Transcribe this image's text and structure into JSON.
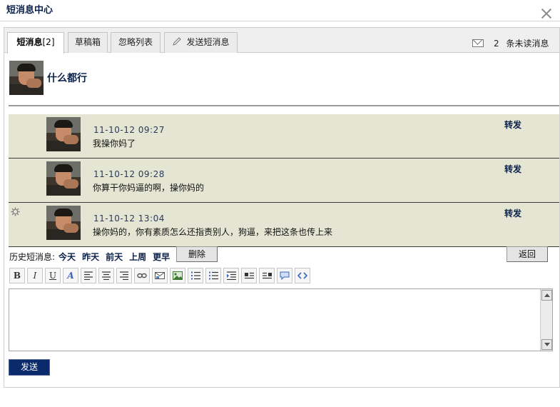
{
  "window": {
    "title": "短消息中心"
  },
  "tabs": {
    "inbox_label": "短消息",
    "inbox_count": "[2]",
    "drafts": "草稿箱",
    "ignore_list": "忽略列表",
    "compose": "发送短消息"
  },
  "unread": {
    "count": "2",
    "label": "条未读消息"
  },
  "conversation": {
    "contact": "什么都行"
  },
  "messages": [
    {
      "time": "11-10-12 09:27",
      "text": "我操你妈了",
      "forward": "转发"
    },
    {
      "time": "11-10-12 09:28",
      "text": "你算干你妈逼的啊，操你妈的",
      "forward": "转发"
    },
    {
      "time": "11-10-12 13:04",
      "text": "操你妈的，你有素质怎么还指责别人，狗逼，来把这条也传上来",
      "forward": "转发"
    }
  ],
  "history": {
    "label": "历史短消息:",
    "today": "今天",
    "yesterday": "昨天",
    "day_before": "前天",
    "last_week": "上周",
    "earlier": "更早"
  },
  "actions": {
    "delete": "删除",
    "back": "返回",
    "send": "发送"
  },
  "editor": {
    "bold": "B",
    "italic": "I",
    "underline": "U",
    "color": "A",
    "icons": [
      "align-left-icon",
      "align-center-icon",
      "align-right-icon",
      "link-icon",
      "email-icon",
      "image-icon",
      "ordered-list-icon",
      "unordered-list-icon",
      "indent-icon",
      "float-left-icon",
      "float-right-icon",
      "quote-icon",
      "code-icon"
    ],
    "content": ""
  },
  "colors": {
    "accent": "#0b2a6b",
    "message_bg": "#e5e5d4",
    "title": "#0b2149"
  }
}
